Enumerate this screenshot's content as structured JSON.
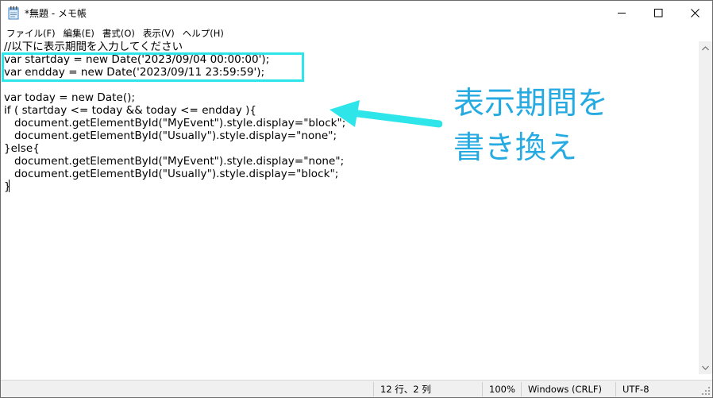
{
  "window": {
    "title": "*無題 - メモ帳"
  },
  "menu": {
    "items": [
      "ファイル(F)",
      "編集(E)",
      "書式(O)",
      "表示(V)",
      "ヘルプ(H)"
    ]
  },
  "editor": {
    "lines": [
      "//以下に表示期間を入力してください",
      "var startday = new Date('2023/09/04 00:00:00');",
      "var endday = new Date('2023/09/11 23:59:59');",
      "",
      "var today = new Date();",
      "if ( startday <= today && today <= endday ){",
      "   document.getElementById(\"MyEvent\").style.display=\"block\";",
      "   document.getElementById(\"Usually\").style.display=\"none\";",
      "}else{",
      "   document.getElementById(\"MyEvent\").style.display=\"none\";",
      "   document.getElementById(\"Usually\").style.display=\"block\";",
      "}"
    ]
  },
  "annotation": {
    "line1": "表示期間を",
    "line2": "書き換え",
    "color": "#25aae1",
    "box_color": "#2ee6ea"
  },
  "status": {
    "position": "12 行、2 列",
    "zoom": "100%",
    "line_ending": "Windows (CRLF)",
    "encoding": "UTF-8"
  },
  "icons": {
    "app": "notepad-icon",
    "minimize": "minimize-icon",
    "maximize": "maximize-icon",
    "close": "close-icon"
  }
}
